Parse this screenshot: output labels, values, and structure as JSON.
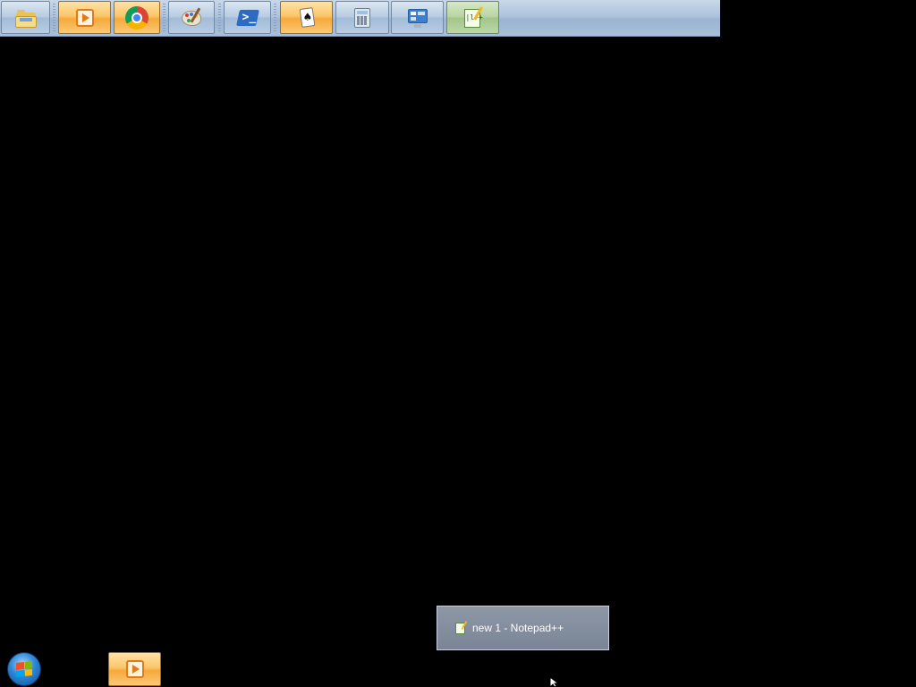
{
  "top_taskbar": {
    "buttons": [
      {
        "name": "windows-explorer",
        "icon": "folder-icon",
        "state": "normal"
      },
      {
        "name": "media-player",
        "icon": "media-player-icon",
        "state": "active"
      },
      {
        "name": "chrome",
        "icon": "chrome-icon",
        "state": "active"
      },
      {
        "name": "paint",
        "icon": "paint-palette-icon",
        "state": "normal"
      },
      {
        "name": "powershell",
        "icon": "powershell-icon",
        "state": "normal"
      },
      {
        "name": "solitaire",
        "icon": "solitaire-card-icon",
        "state": "active"
      },
      {
        "name": "calculator",
        "icon": "calculator-icon",
        "state": "normal"
      },
      {
        "name": "control-panel",
        "icon": "control-panel-icon",
        "state": "normal"
      },
      {
        "name": "notepad-plus-plus",
        "icon": "notepad-plus-plus-icon",
        "state": "highlighted"
      }
    ]
  },
  "preview_popup": {
    "title": "new 1 - Notepad++",
    "icon": "notepad-plus-plus-icon"
  },
  "bottom_bar": {
    "start_icon": "windows-start-orb-icon",
    "media_icon": "media-player-icon"
  },
  "colors": {
    "desktop_background": "#000000",
    "taskbar_blue": "#aec3dc",
    "active_orange": "#f6a93a",
    "preview_gray": "#7a8597"
  }
}
